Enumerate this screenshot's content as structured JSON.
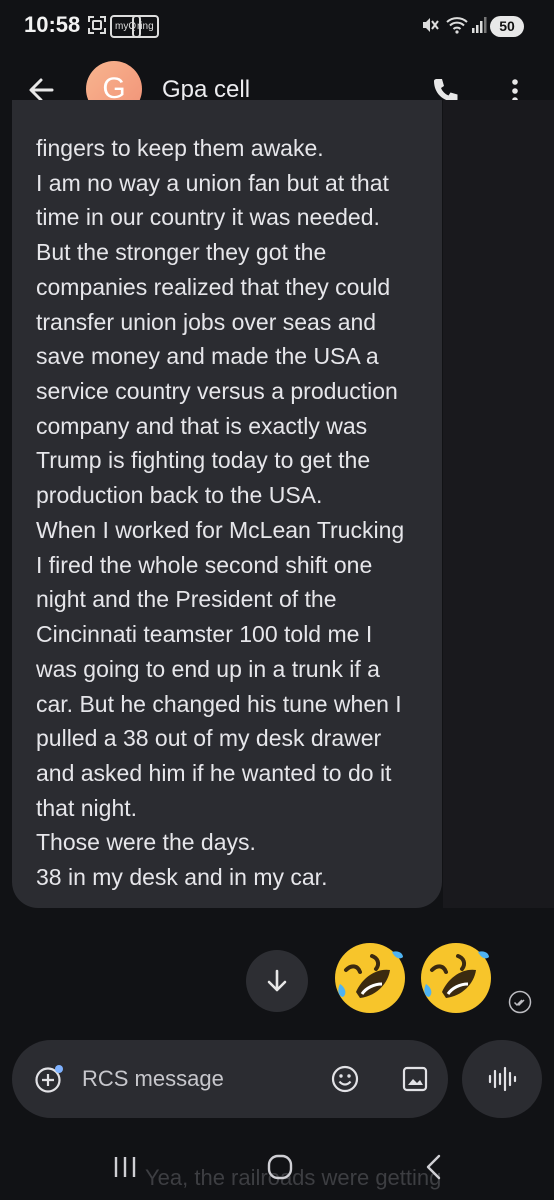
{
  "status_bar": {
    "time": "10:58",
    "icons": [
      "screenshot-icon",
      "myq-app-icon",
      "ring-app-icon",
      "mute-icon",
      "wifi-icon",
      "signal-icon"
    ],
    "myq_label": "myQ",
    "ring_label": "ring",
    "battery": "50"
  },
  "header": {
    "avatar_letter": "G",
    "contact_name": "Gpa cell"
  },
  "message": {
    "lines": [
      "fingers to keep them awake.",
      "I am no way a union fan but at that",
      "time in our country it was needed.",
      "But the stronger they got the",
      "companies realized that they could",
      "transfer union jobs over seas and",
      "save money and made the USA a",
      "service country versus a production",
      "company and that is exactly was",
      "Trump is fighting today to get the",
      "production back to the USA.",
      "When I worked for McLean Trucking",
      "I fired the whole second shift one",
      "night and the President of the",
      "Cincinnati teamster 100 told me I",
      "was going to end up in a trunk if a",
      "car. But he changed his tune when I",
      "pulled a 38 out of my desk drawer",
      "and asked him if he wanted to do it",
      "that night.",
      "Those were the days.",
      "38 in my desk and in my car."
    ]
  },
  "reactions": [
    "rolling-laughing-emoji",
    "rolling-laughing-emoji"
  ],
  "compose": {
    "placeholder": "RCS message"
  },
  "background_text": "Yea, the railroads were getting",
  "colors": {
    "background": "#111215",
    "bubble": "#2b2c31",
    "avatar": "#f4a07f"
  }
}
